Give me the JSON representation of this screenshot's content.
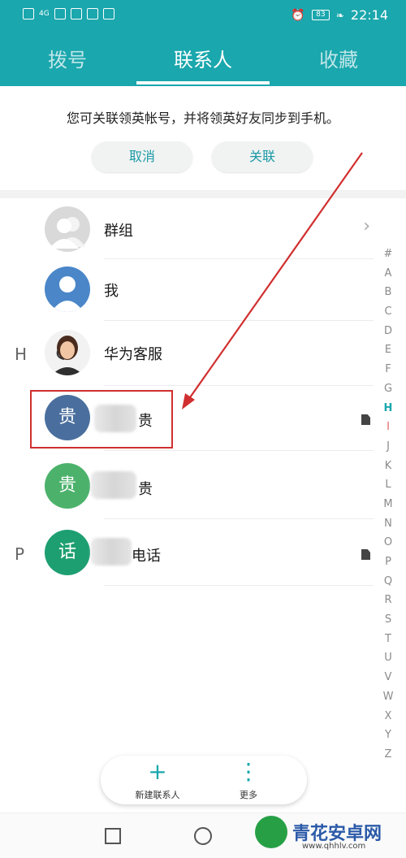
{
  "status": {
    "time": "22:14",
    "battery": "83",
    "network": "4G"
  },
  "tabs": [
    {
      "label": "拨号",
      "active": false
    },
    {
      "label": "联系人",
      "active": true
    },
    {
      "label": "收藏",
      "active": false
    }
  ],
  "prompt": {
    "text": "您可关联领英帐号，并将领英好友同步到手机。",
    "cancel_label": "取消",
    "link_label": "关联"
  },
  "contacts": [
    {
      "section": "",
      "avatar_text": "",
      "label": "群组",
      "avatar": "group-icon"
    },
    {
      "section": "",
      "avatar_text": "",
      "label": "我",
      "avatar": "person-icon"
    },
    {
      "section": "H",
      "avatar_text": "",
      "label": "华为客服",
      "avatar": "service-photo"
    },
    {
      "section": "",
      "avatar_text": "贵",
      "label": "贵",
      "avatar_color": "#4a6f9e"
    },
    {
      "section": "",
      "avatar_text": "贵",
      "label": "贵",
      "avatar_color": "#4cb26b"
    },
    {
      "section": "P",
      "avatar_text": "话",
      "label": "电话",
      "avatar_color": "#1e9f72"
    }
  ],
  "alphabet": [
    "#",
    "A",
    "B",
    "C",
    "D",
    "E",
    "F",
    "G",
    "H",
    "I",
    "J",
    "K",
    "L",
    "M",
    "N",
    "O",
    "P",
    "Q",
    "R",
    "S",
    "T",
    "U",
    "V",
    "W",
    "X",
    "Y",
    "Z"
  ],
  "alphabet_current": "H",
  "bottom_bar": {
    "new_contact_label": "新建联系人",
    "more_label": "更多"
  },
  "watermark": {
    "title": "青花安卓网",
    "url": "www.qhhlv.com"
  },
  "colors": {
    "accent": "#1aa7ad",
    "annotation": "#d12f2f"
  }
}
